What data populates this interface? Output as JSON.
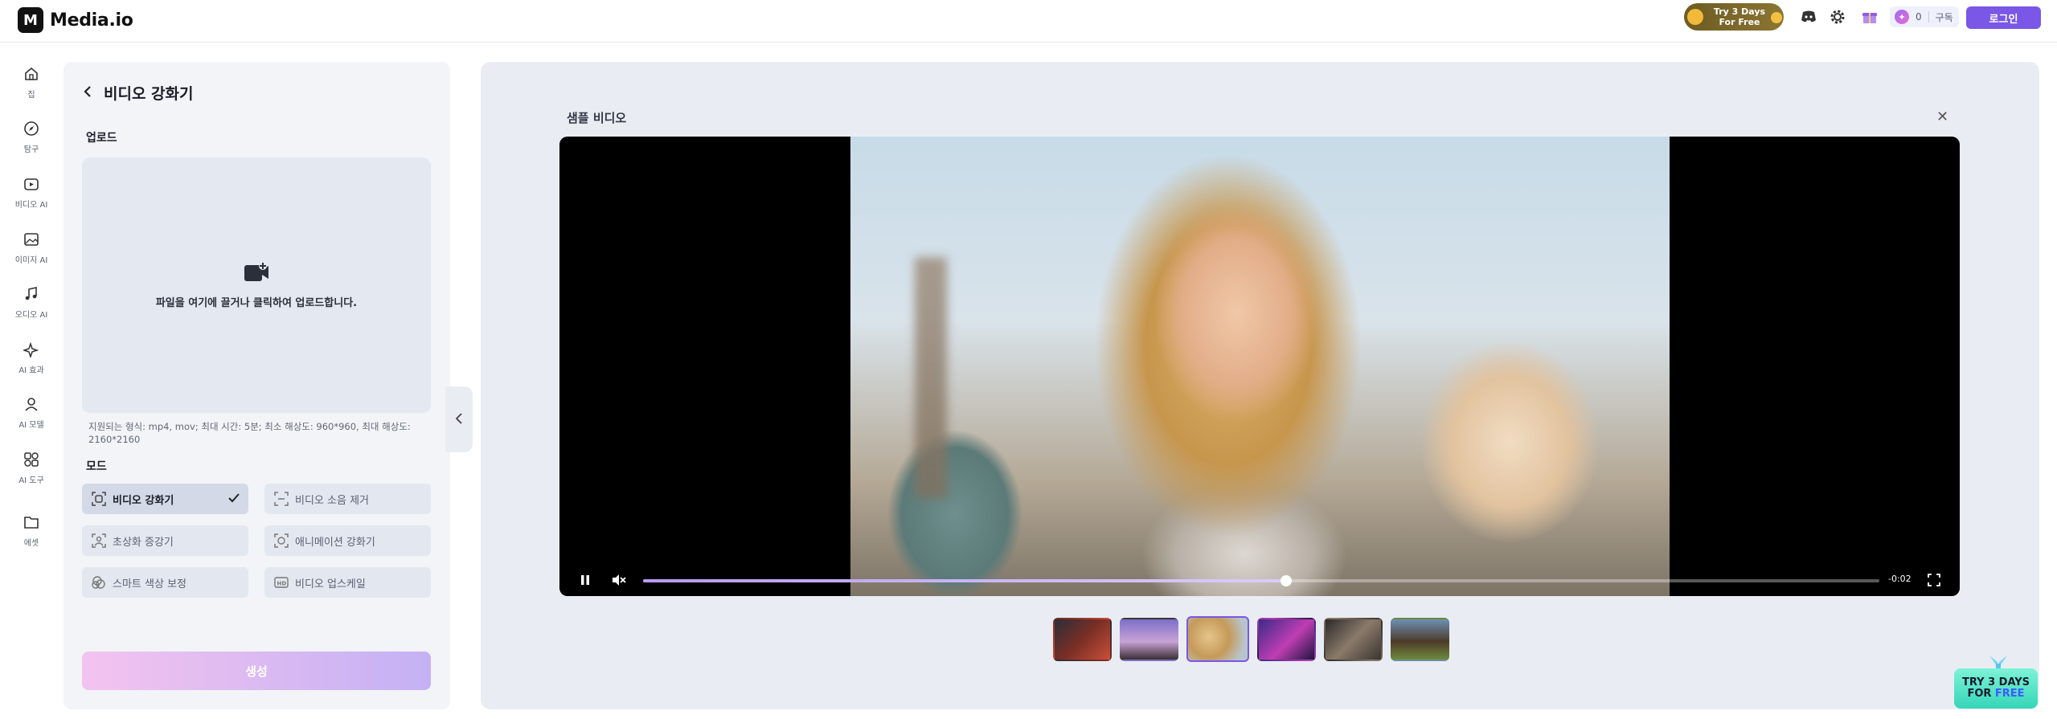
{
  "app": {
    "logo_text": "Media.io",
    "logo_mark": "M"
  },
  "topbar": {
    "promo_line1": "Try 3 Days",
    "promo_line2": "For Free",
    "credits_count": "0",
    "subscribe_label": "구독",
    "login_label": "로그인"
  },
  "nav": [
    {
      "icon": "home-icon",
      "label": "집"
    },
    {
      "icon": "compass-icon",
      "label": "탐구"
    },
    {
      "icon": "video-ai-icon",
      "label": "비디오 AI"
    },
    {
      "icon": "image-ai-icon",
      "label": "이미지 AI"
    },
    {
      "icon": "music-icon",
      "label": "오디오 AI"
    },
    {
      "icon": "sparkle-icon",
      "label": "AI 효과"
    },
    {
      "icon": "person-icon",
      "label": "AI 모델"
    },
    {
      "icon": "tools-icon",
      "label": "AI 도구"
    },
    {
      "icon": "folder-icon",
      "label": "에셋"
    }
  ],
  "panel": {
    "title": "비디오 강화기",
    "upload_label": "업로드",
    "dropzone_text": "파일을 여기에 끌거나 클릭하여 업로드합니다.",
    "hint_text": "지원되는 형식: mp4, mov; 최대 시간: 5분; 최소 해상도: 960*960, 최대 해상도: 2160*2160",
    "mode_label": "모드",
    "modes": [
      {
        "label": "비디오 강화기",
        "active": true
      },
      {
        "label": "비디오 소음 제거",
        "active": false
      },
      {
        "label": "초상화 증강기",
        "active": false
      },
      {
        "label": "애니메이션 강화기",
        "active": false
      },
      {
        "label": "스마트 색상 보정",
        "active": false
      },
      {
        "label": "비디오 업스케일",
        "active": false
      }
    ],
    "generate_label": "생성"
  },
  "main": {
    "sample_title": "샘플 비디오",
    "time_remaining": "-0:02",
    "progress_fraction": 0.52
  },
  "corner_promo": {
    "line1": "TRY 3 DAYS",
    "line2a": "FOR ",
    "line2b": "FREE"
  },
  "colors": {
    "accent": "#7a57e6",
    "panel_bg": "#f2f4f8",
    "main_bg": "#e9edf3"
  }
}
